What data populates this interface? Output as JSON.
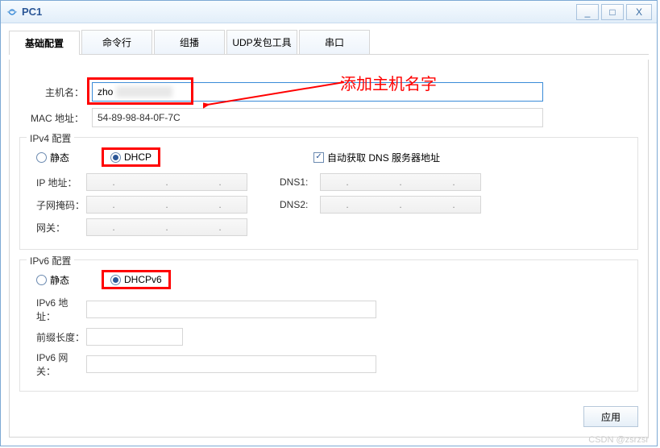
{
  "window": {
    "title": "PC1"
  },
  "tabs": {
    "basic": "基础配置",
    "cmd": "命令行",
    "multicast": "组播",
    "udp": "UDP发包工具",
    "serial": "串口"
  },
  "annotation": {
    "addHostName": "添加主机名字"
  },
  "fields": {
    "hostname_label": "主机名：",
    "hostname_value": "zho",
    "mac_label": "MAC 地址：",
    "mac_value": "54-89-98-84-0F-7C"
  },
  "ipv4": {
    "section": "IPv4 配置",
    "static": "静态",
    "dhcp": "DHCP",
    "auto_dns": "自动获取 DNS 服务器地址",
    "ip_label": "IP 地址：",
    "mask_label": "子网掩码：",
    "gateway_label": "网关：",
    "dns1": "DNS1:",
    "dns2": "DNS2:"
  },
  "ipv6": {
    "section": "IPv6 配置",
    "static": "静态",
    "dhcpv6": "DHCPv6",
    "ip_label": "IPv6 地址：",
    "prefix_label": "前缀长度：",
    "gateway_label": "IPv6 网关："
  },
  "buttons": {
    "apply": "应用"
  },
  "checkbox_glyph": "☑",
  "watermarks": {
    "csdn": "CSDN @zsrzsr"
  }
}
